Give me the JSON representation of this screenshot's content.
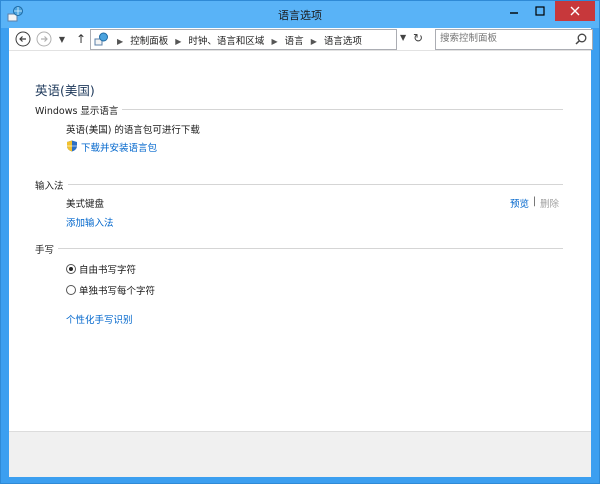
{
  "window": {
    "title": "语言选项"
  },
  "nav": {
    "breadcrumbs": [
      "控制面板",
      "时钟、语言和区域",
      "语言",
      "语言选项"
    ],
    "search_placeholder": "搜索控制面板"
  },
  "language": {
    "heading": "英语(美国)",
    "display_section": {
      "label": "Windows 显示语言",
      "status": "英语(美国) 的语言包可进行下载",
      "download_link": "下载并安装语言包"
    },
    "input_section": {
      "label": "输入法",
      "method_name": "美式键盘",
      "preview_link": "预览",
      "separator": "|",
      "remove_label": "删除",
      "add_link": "添加输入法"
    },
    "handwriting_section": {
      "label": "手写",
      "options": [
        {
          "label": "自由书写字符",
          "selected": true
        },
        {
          "label": "单独书写每个字符",
          "selected": false
        }
      ],
      "personalize_link": "个性化手写识别"
    }
  },
  "colors": {
    "title_bar": "#59b3f7",
    "link": "#0066cc",
    "heading": "#1e395b",
    "close": "#c7383b"
  }
}
